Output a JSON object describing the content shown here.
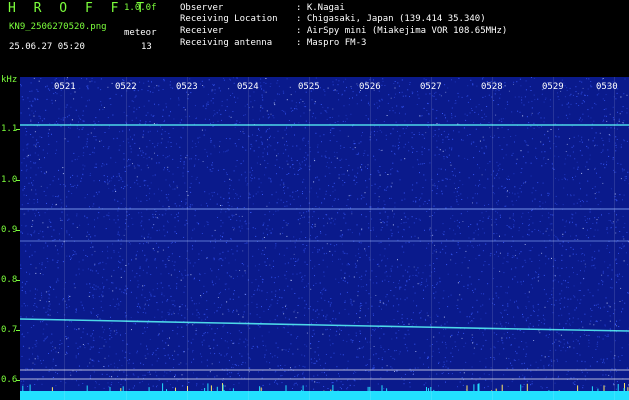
{
  "header": {
    "app_title": "H R O F F T",
    "version": "1.0.0f",
    "filename": "KN9_2506270520.png",
    "meteor_label": "meteor",
    "datetime": "25.06.27 05:20",
    "meteor_count": "13",
    "info": [
      {
        "key": "Observer",
        "value": ": K.Nagai"
      },
      {
        "key": "Receiving Location",
        "value": ": Chigasaki, Japan (139.414 35.340)"
      },
      {
        "key": "Receiver",
        "value": ": AirSpy mini (Miakejima VOR 108.65MHz)"
      },
      {
        "key": "Receiving antenna",
        "value": ": Maspro FM-3"
      }
    ]
  },
  "spectrogram": {
    "y_unit": "kHz",
    "y_ticks": [
      "1.1",
      "1.0",
      "0.9",
      "0.8",
      "0.7",
      "0.6"
    ],
    "x_ticks": [
      "0521",
      "0522",
      "0523",
      "0524",
      "0525",
      "0526",
      "0527",
      "0528",
      "0529",
      "0530"
    ],
    "colors": {
      "background": "#0a1a8c",
      "noise": "#3a5cff",
      "trace": "#4dd8e8",
      "label_green": "#7cff3c"
    }
  }
}
